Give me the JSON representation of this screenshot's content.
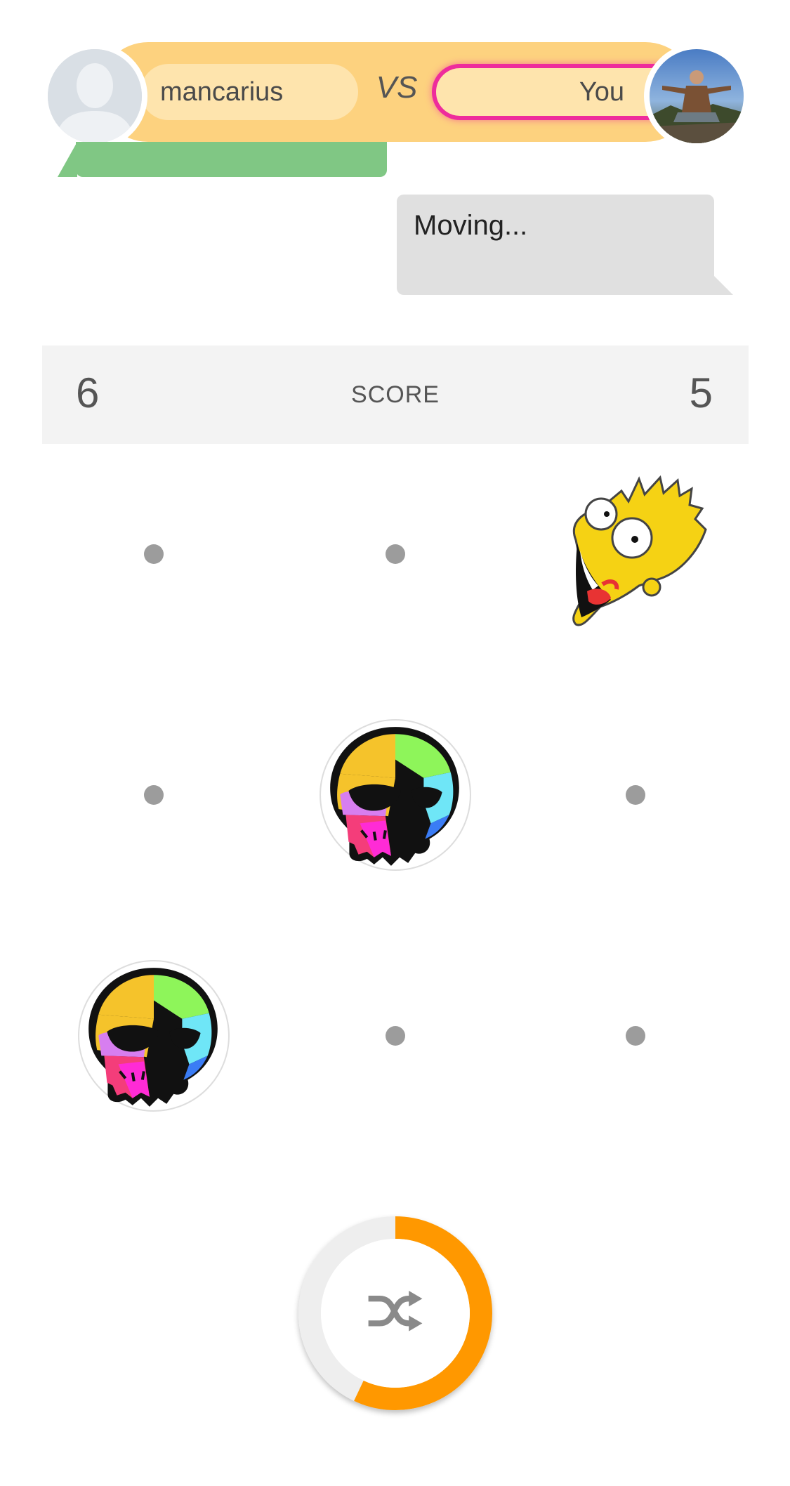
{
  "versus": {
    "opponent_name": "mancarius",
    "vs_text": "VS",
    "player_name": "You",
    "opponent_avatar": "default-user-silhouette",
    "player_avatar": "user-photo",
    "accent_color": "#ee2c9c",
    "bar_color": "#fdd27f",
    "turn_timer_fraction": 0.43
  },
  "status": {
    "message": "Moving..."
  },
  "score": {
    "opponent": "6",
    "label": "SCORE",
    "player": "5"
  },
  "board": {
    "rows": [
      [
        "empty",
        "empty",
        "bart"
      ],
      [
        "empty",
        "skull",
        "empty"
      ],
      [
        "skull",
        "empty",
        "empty"
      ]
    ]
  },
  "shuffle": {
    "icon": "shuffle-icon",
    "progress_fraction": 0.57,
    "progress_color": "#ff9800",
    "track_color": "#eeeeee"
  }
}
